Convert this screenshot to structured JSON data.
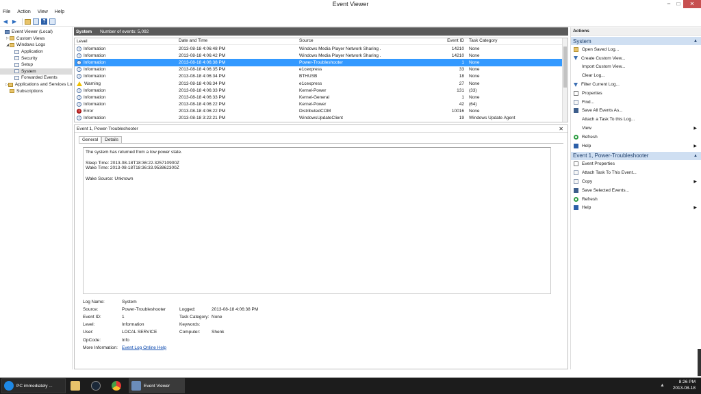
{
  "window": {
    "title": "Event Viewer",
    "minimize": "–",
    "maximize": "□",
    "close": "✕"
  },
  "menu": [
    "File",
    "Action",
    "View",
    "Help"
  ],
  "tree": [
    {
      "label": "Event Viewer (Local)",
      "indent": 0,
      "expander": "",
      "icon": "pc"
    },
    {
      "label": "Custom Views",
      "indent": 1,
      "expander": "▷",
      "icon": "fold"
    },
    {
      "label": "Windows Logs",
      "indent": 1,
      "expander": "◢",
      "icon": "fold"
    },
    {
      "label": "Application",
      "indent": 2,
      "expander": "",
      "icon": "log"
    },
    {
      "label": "Security",
      "indent": 2,
      "expander": "",
      "icon": "log"
    },
    {
      "label": "Setup",
      "indent": 2,
      "expander": "",
      "icon": "log"
    },
    {
      "label": "System",
      "indent": 2,
      "expander": "",
      "icon": "log",
      "selected": true
    },
    {
      "label": "Forwarded Events",
      "indent": 2,
      "expander": "",
      "icon": "log"
    },
    {
      "label": "Applications and Services Lo",
      "indent": 1,
      "expander": "▷",
      "icon": "fold"
    },
    {
      "label": "Subscriptions",
      "indent": 1,
      "expander": "",
      "icon": "fold"
    }
  ],
  "list": {
    "name": "System",
    "count": "Number of events: 5,092",
    "columns": [
      "Level",
      "Date and Time",
      "Source",
      "Event ID",
      "Task Category"
    ],
    "rows": [
      {
        "level": "Information",
        "type": "info",
        "date": "2013-08-18 4:06:48 PM",
        "source": "Windows Media Player Network Sharing ...",
        "id": "14210",
        "task": "None"
      },
      {
        "level": "Information",
        "type": "info",
        "date": "2013-08-18 4:06:42 PM",
        "source": "Windows Media Player Network Sharing ...",
        "id": "14210",
        "task": "None"
      },
      {
        "level": "Information",
        "type": "info",
        "date": "2013-08-18 4:06:38 PM",
        "source": "Power-Troubleshooter",
        "id": "1",
        "task": "None",
        "selected": true
      },
      {
        "level": "Information",
        "type": "info",
        "date": "2013-08-18 4:06:35 PM",
        "source": "e1cexpress",
        "id": "33",
        "task": "None"
      },
      {
        "level": "Information",
        "type": "info",
        "date": "2013-08-18 4:06:34 PM",
        "source": "BTHUSB",
        "id": "18",
        "task": "None"
      },
      {
        "level": "Warning",
        "type": "warn",
        "date": "2013-08-18 4:06:34 PM",
        "source": "e1cexpress",
        "id": "27",
        "task": "None"
      },
      {
        "level": "Information",
        "type": "info",
        "date": "2013-08-18 4:06:33 PM",
        "source": "Kernel-Power",
        "id": "131",
        "task": "(33)"
      },
      {
        "level": "Information",
        "type": "info",
        "date": "2013-08-18 4:06:33 PM",
        "source": "Kernel-General",
        "id": "1",
        "task": "None"
      },
      {
        "level": "Information",
        "type": "info",
        "date": "2013-08-18 4:06:22 PM",
        "source": "Kernel-Power",
        "id": "42",
        "task": "(64)"
      },
      {
        "level": "Error",
        "type": "err",
        "date": "2013-08-18 4:06:22 PM",
        "source": "DistributedCOM",
        "id": "10016",
        "task": "None"
      },
      {
        "level": "Information",
        "type": "info",
        "date": "2013-08-18 3:22:21 PM",
        "source": "WindowsUpdateClient",
        "id": "19",
        "task": "Windows Update Agent"
      }
    ]
  },
  "detail": {
    "header": "Event 1, Power-Troubleshooter",
    "close": "✕",
    "tabs": [
      "General",
      "Details"
    ],
    "message": [
      "The system has returned from a low power state.",
      "",
      "Sleep Time: 2013-08-18T18:36:22.325710900Z",
      "Wake Time: 2013-08-18T18:36:33.953862300Z",
      "",
      "Wake Source: Unknown"
    ],
    "props": {
      "log_name_k": "Log Name:",
      "log_name_v": "System",
      "source_k": "Source:",
      "source_v": "Power-Troubleshooter",
      "logged_k": "Logged:",
      "logged_v": "2013-08-18 4:06:38 PM",
      "event_id_k": "Event ID:",
      "event_id_v": "1",
      "task_k": "Task Category:",
      "task_v": "None",
      "level_k": "Level:",
      "level_v": "Information",
      "keywords_k": "Keywords:",
      "keywords_v": "",
      "user_k": "User:",
      "user_v": "LOCAL SERVICE",
      "computer_k": "Computer:",
      "computer_v": "Shenk",
      "opcode_k": "OpCode:",
      "opcode_v": "Info",
      "more_k": "More Information:",
      "more_v": "Event Log Online Help"
    }
  },
  "actions": {
    "title": "Actions",
    "section1": "System",
    "items1": [
      {
        "label": "Open Saved Log...",
        "icon": "fold"
      },
      {
        "label": "Create Custom View...",
        "icon": "filt"
      },
      {
        "label": "Import Custom View...",
        "icon": "none"
      },
      {
        "label": "Clear Log...",
        "icon": "none"
      },
      {
        "label": "Filter Current Log...",
        "icon": "filt"
      },
      {
        "label": "Properties",
        "icon": "prop"
      },
      {
        "label": "Find...",
        "icon": "doc"
      },
      {
        "label": "Save All Events As...",
        "icon": "save"
      },
      {
        "label": "Attach a Task To this Log...",
        "icon": "none"
      },
      {
        "label": "View",
        "icon": "none",
        "submenu": true
      },
      {
        "label": "Refresh",
        "icon": "ref"
      },
      {
        "label": "Help",
        "icon": "help",
        "submenu": true
      }
    ],
    "section2": "Event 1, Power-Troubleshooter",
    "items2": [
      {
        "label": "Event Properties",
        "icon": "prop"
      },
      {
        "label": "Attach Task To This Event...",
        "icon": "doc"
      },
      {
        "label": "Copy",
        "icon": "doc",
        "submenu": true
      },
      {
        "label": "Save Selected Events...",
        "icon": "save"
      },
      {
        "label": "Refresh",
        "icon": "ref"
      },
      {
        "label": "Help",
        "icon": "help",
        "submenu": true
      }
    ]
  },
  "taskbar": {
    "ie_label": "PC immediately ...",
    "ev_label": "Event Viewer",
    "time": "8:26 PM",
    "date": "2013-08-18"
  }
}
